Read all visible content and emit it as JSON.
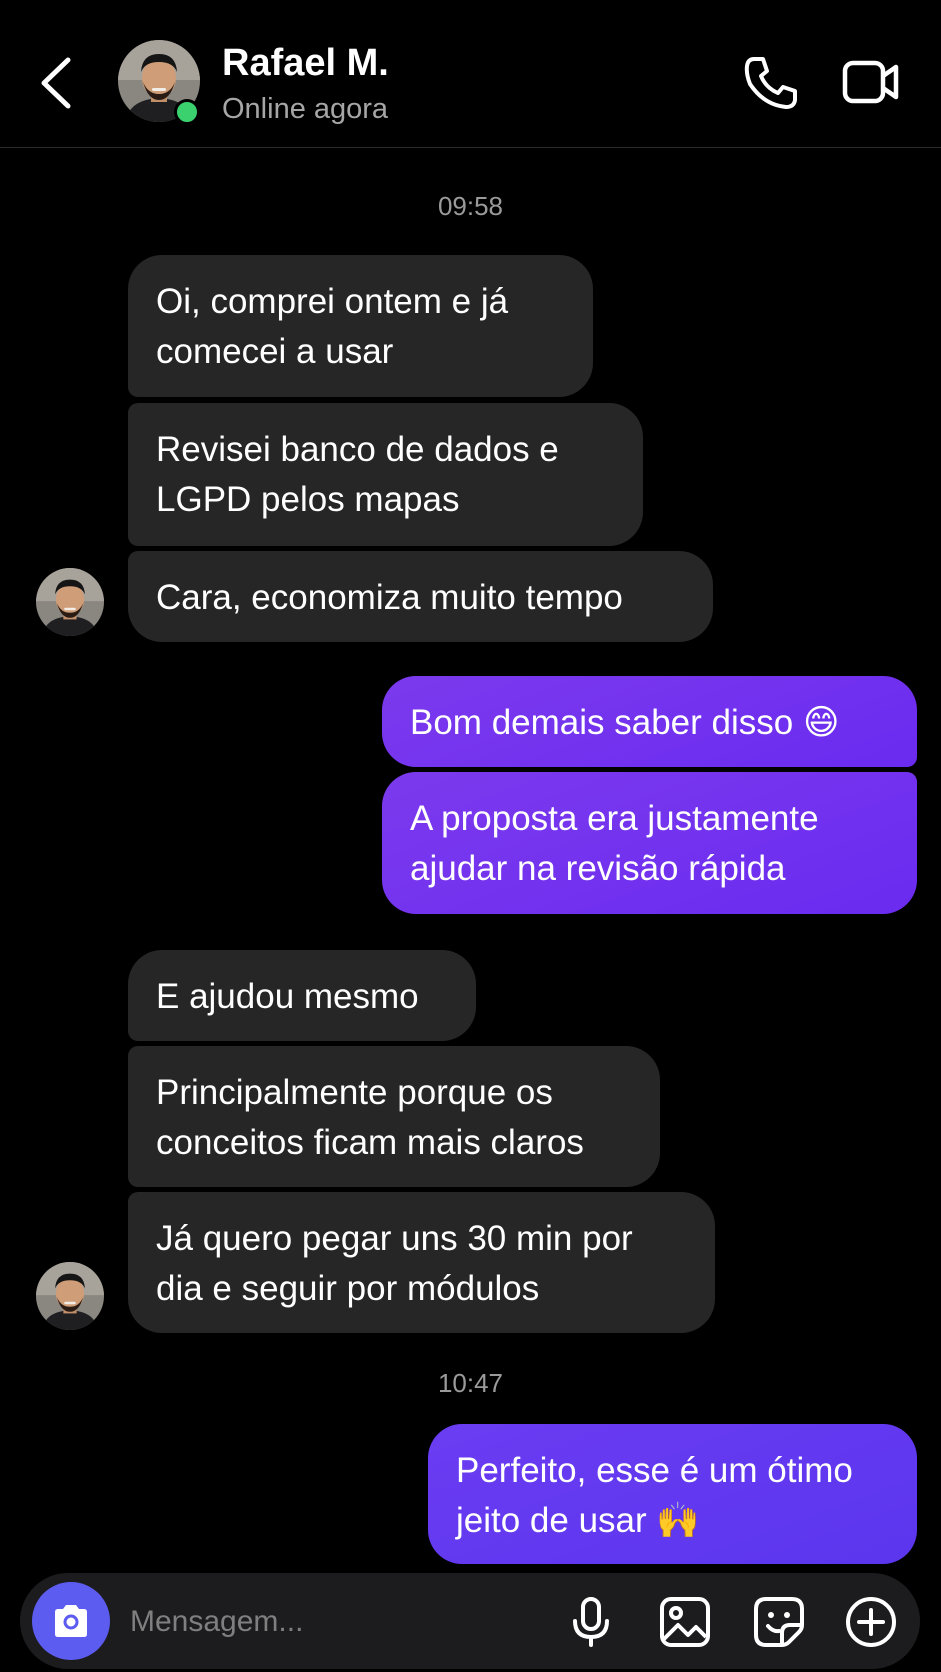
{
  "header": {
    "contact_name": "Rafael M.",
    "status": "Online agora",
    "icons": [
      "back-chevron-icon",
      "phone-icon",
      "video-camera-icon"
    ],
    "online_color": "#3bd16f"
  },
  "timestamps": [
    "09:58",
    "10:47"
  ],
  "messages": [
    {
      "from": "them",
      "lines": [
        "Oi, comprei ontem e já",
        "comecei a usar"
      ]
    },
    {
      "from": "them",
      "lines": [
        "Revisei banco de dados e",
        "LGPD pelos mapas"
      ]
    },
    {
      "from": "them",
      "lines": [
        "Cara, economiza muito tempo"
      ]
    },
    {
      "from": "me",
      "lines": [
        "Bom demais saber disso 😄"
      ]
    },
    {
      "from": "me",
      "lines": [
        "A proposta era justamente",
        "ajudar na revisão rápida"
      ]
    },
    {
      "from": "them",
      "lines": [
        "E ajudou mesmo"
      ]
    },
    {
      "from": "them",
      "lines": [
        "Principalmente porque os",
        "conceitos ficam mais claros"
      ]
    },
    {
      "from": "them",
      "lines": [
        "Já quero pegar uns 30 min por",
        "dia e seguir por módulos"
      ]
    },
    {
      "from": "me",
      "lines": [
        "Perfeito, esse é um ótimo",
        "jeito de usar 🙌"
      ]
    }
  ],
  "composer": {
    "placeholder": "Mensagem...",
    "icons": [
      "camera-icon",
      "microphone-icon",
      "gallery-icon",
      "sticker-icon",
      "plus-icon"
    ]
  },
  "colors": {
    "incoming_bubble": "#262626",
    "outgoing_bubble": "#7c3aed",
    "camera_button": "#5d5cf0"
  }
}
